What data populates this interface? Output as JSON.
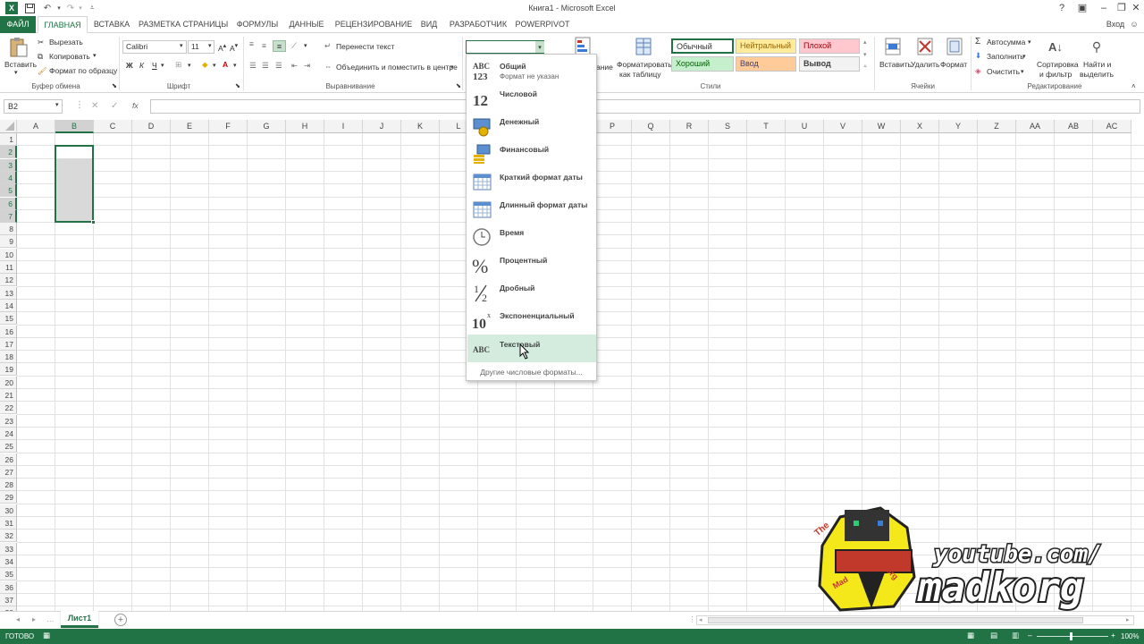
{
  "window": {
    "title": "Книга1 - Microsoft Excel",
    "help": "?",
    "login": "Вход"
  },
  "tabs": [
    "ФАЙЛ",
    "ГЛАВНАЯ",
    "ВСТАВКА",
    "РАЗМЕТКА СТРАНИЦЫ",
    "ФОРМУЛЫ",
    "ДАННЫЕ",
    "РЕЦЕНЗИРОВАНИЕ",
    "ВИД",
    "РАЗРАБОТЧИК",
    "POWERPIVOT"
  ],
  "ribbon": {
    "clipboard": {
      "label": "Буфер обмена",
      "paste": "Вставить",
      "cut": "Вырезать",
      "copy": "Копировать",
      "painter": "Формат по образцу"
    },
    "font": {
      "label": "Шрифт",
      "name": "Calibri",
      "size": "11",
      "bold": "Ж",
      "italic": "К",
      "underline": "Ч"
    },
    "alignment": {
      "label": "Выравнивание",
      "wrap": "Перенести текст",
      "merge": "Объединить и поместить в центре"
    },
    "number": {
      "format_value": ""
    },
    "styles": {
      "label": "Стили",
      "cond_partial": "ание",
      "format_table": "Форматировать",
      "format_table2": "как таблицу",
      "normal": "Обычный",
      "neutral": "Нейтральный",
      "bad": "Плохой",
      "good": "Хороший",
      "input": "Ввод",
      "output": "Вывод"
    },
    "cells": {
      "label": "Ячейки",
      "insert": "Вставить",
      "delete": "Удалить",
      "format": "Формат"
    },
    "editing": {
      "label": "Редактирование",
      "autosum": "Автосумма",
      "fill": "Заполнить",
      "clear": "Очистить",
      "sort": "Сортировка",
      "sort2": "и фильтр",
      "find": "Найти и",
      "find2": "выделить"
    }
  },
  "formula_bar": {
    "name_box": "B2",
    "fx": "fx",
    "value": ""
  },
  "columns": [
    "A",
    "B",
    "C",
    "D",
    "E",
    "F",
    "G",
    "H",
    "I",
    "J",
    "K",
    "L",
    "M",
    "N",
    "O",
    "P",
    "Q",
    "R",
    "S",
    "T",
    "U",
    "V",
    "W",
    "X",
    "Y",
    "Z",
    "AA",
    "AB",
    "AC"
  ],
  "rows": [
    "1",
    "2",
    "3",
    "4",
    "5",
    "6",
    "7",
    "8",
    "9",
    "10",
    "11",
    "12",
    "13",
    "14",
    "15",
    "16",
    "17",
    "18",
    "19",
    "20",
    "21",
    "22",
    "23",
    "24",
    "25",
    "26",
    "27",
    "28",
    "29",
    "30",
    "31",
    "32",
    "33",
    "34",
    "35",
    "36",
    "37",
    "38"
  ],
  "selection": {
    "active_cell": "B2",
    "range": "B2:B7"
  },
  "number_format_menu": {
    "items": [
      {
        "label": "Общий",
        "sub": "Формат не указан",
        "icon": "abc123-icon"
      },
      {
        "label": "Числовой",
        "icon": "number-12-icon"
      },
      {
        "label": "Денежный",
        "icon": "currency-icon"
      },
      {
        "label": "Финансовый",
        "icon": "accounting-icon"
      },
      {
        "label": "Краткий формат даты",
        "icon": "short-date-icon"
      },
      {
        "label": "Длинный формат даты",
        "icon": "long-date-icon"
      },
      {
        "label": "Время",
        "icon": "clock-icon"
      },
      {
        "label": "Процентный",
        "icon": "percent-icon"
      },
      {
        "label": "Дробный",
        "icon": "fraction-icon"
      },
      {
        "label": "Экспоненциальный",
        "icon": "scientific-icon"
      },
      {
        "label": "Текстовый",
        "icon": "text-abc-icon",
        "highlighted": true
      }
    ],
    "more": "Другие числовые форматы...",
    "icon_text": {
      "abc": "ABC",
      "n123": "123",
      "n12": "12",
      "pct": "%",
      "one": "1",
      "two": "2",
      "ten": "10",
      "exp": "x"
    }
  },
  "sheet_tabs": [
    "Лист1"
  ],
  "status": {
    "ready": "ГОТОВО",
    "zoom": "100%"
  },
  "watermark": {
    "line1": "youtube.com/",
    "line2": "madkorg",
    "badge1": "The",
    "badge2": "Mad",
    "badge3": "Korg"
  },
  "colors": {
    "accent": "#217346",
    "selection_fill": "#d9d9d9",
    "highlight": "#d3ecdd"
  }
}
